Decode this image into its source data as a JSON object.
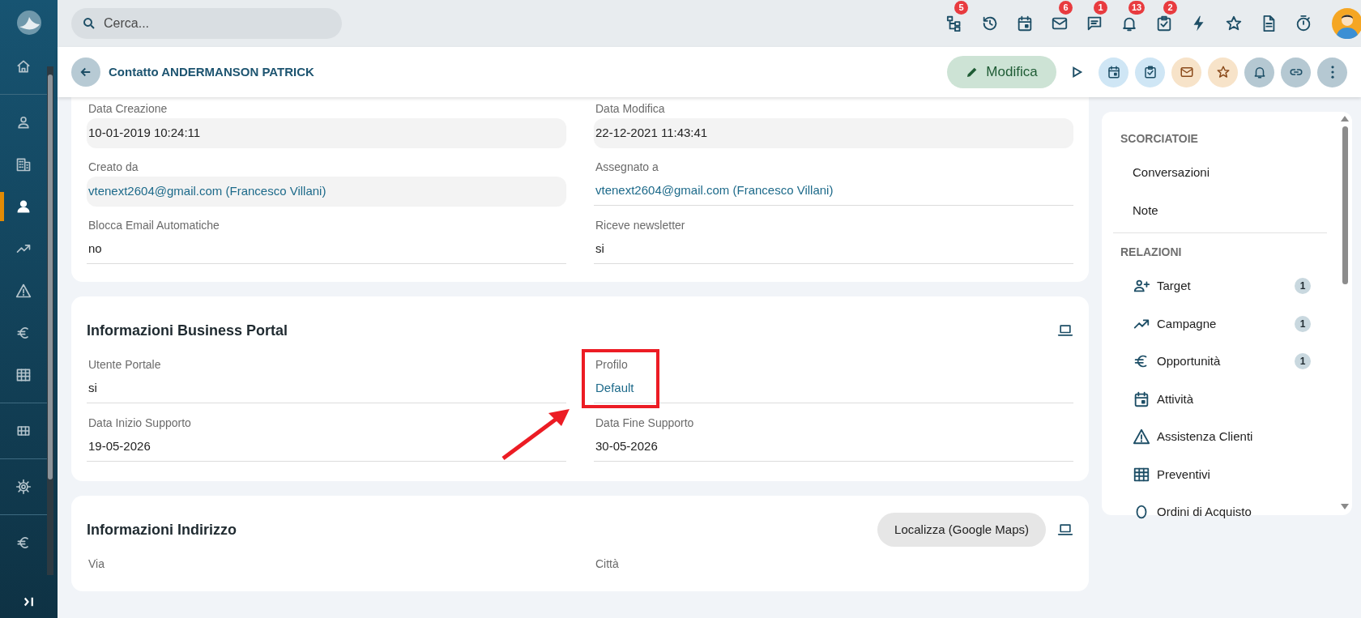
{
  "sidebar": {
    "items": [
      {
        "kind": "home",
        "selected": false
      },
      {
        "kind": "person-outline",
        "selected": false
      },
      {
        "kind": "building",
        "selected": false
      },
      {
        "kind": "person",
        "selected": true
      },
      {
        "kind": "trend",
        "selected": false
      },
      {
        "kind": "warning",
        "selected": false
      },
      {
        "kind": "euro",
        "selected": false
      },
      {
        "kind": "table",
        "selected": false
      },
      {
        "kind": "grid",
        "selected": false
      },
      {
        "kind": "gear",
        "selected": false
      },
      {
        "kind": "euro",
        "selected": false
      }
    ]
  },
  "search": {
    "placeholder": "Cerca..."
  },
  "toolbar_icons": [
    {
      "kind": "hierarchy",
      "badge": "5"
    },
    {
      "kind": "history"
    },
    {
      "kind": "calendar"
    },
    {
      "kind": "mail",
      "badge": "6"
    },
    {
      "kind": "chat",
      "badge": "1"
    },
    {
      "kind": "bell",
      "badge": "13"
    },
    {
      "kind": "task",
      "badge": "2"
    },
    {
      "kind": "bolt"
    },
    {
      "kind": "star"
    },
    {
      "kind": "document"
    },
    {
      "kind": "timer"
    }
  ],
  "header": {
    "title": "Contatto ANDERMANSON PATRICK",
    "edit_button": "Modifica",
    "actions": [
      {
        "kind": "calendar",
        "color": "#cfe6f5"
      },
      {
        "kind": "task",
        "color": "#cfe6f5"
      },
      {
        "kind": "mail",
        "color": "#f7e3c9"
      },
      {
        "kind": "star",
        "color": "#f7e3c9"
      },
      {
        "kind": "bell",
        "color": "#b5c8d2"
      },
      {
        "kind": "link",
        "color": "#b5c8d2"
      },
      {
        "kind": "more",
        "color": "#b5c8d2"
      }
    ]
  },
  "sections": [
    {
      "fields": [
        {
          "label": "Data Creazione",
          "value": "10-01-2019 10:24:11",
          "kind": "readonly",
          "link": false,
          "highlighted": false
        },
        {
          "label": "Data Modifica",
          "value": "22-12-2021 11:43:41",
          "kind": "readonly",
          "link": false,
          "highlighted": false
        },
        {
          "label": "Creato da",
          "value": "vtenext2604@gmail.com (Francesco Villani)",
          "kind": "readonly",
          "link": true,
          "highlighted": false
        },
        {
          "label": "Assegnato a",
          "value": "vtenext2604@gmail.com (Francesco Villani)",
          "kind": "editable",
          "link": true,
          "highlighted": false
        },
        {
          "label": "Blocca Email Automatiche",
          "value": "no",
          "kind": "editable",
          "link": false,
          "highlighted": false
        },
        {
          "label": "Riceve newsletter",
          "value": "si",
          "kind": "editable",
          "link": false,
          "highlighted": false
        }
      ]
    },
    {
      "title": "Informazioni Business Portal",
      "fields": [
        {
          "label": "Utente Portale",
          "value": "si",
          "kind": "editable",
          "link": false,
          "highlighted": false
        },
        {
          "label": "Profilo",
          "value": "Default",
          "kind": "editable",
          "link": true,
          "highlighted": true
        },
        {
          "label": "Data Inizio Supporto",
          "value": "19-05-2026",
          "kind": "editable",
          "link": false,
          "highlighted": false
        },
        {
          "label": "Data Fine Supporto",
          "value": "30-05-2026",
          "kind": "editable",
          "link": false,
          "highlighted": false
        }
      ]
    },
    {
      "title": "Informazioni Indirizzo",
      "button": "Localizza (Google Maps)",
      "fields": [
        {
          "label": "Via"
        },
        {
          "label": "Città"
        }
      ]
    }
  ],
  "side_panel": {
    "groups": [
      {
        "title": "SCORCIATOIE",
        "items": [
          {
            "label": "Conversazioni",
            "kind": "plain"
          },
          {
            "label": "Note",
            "kind": "plain"
          }
        ]
      },
      {
        "title": "RELAZIONI",
        "items": [
          {
            "label": "Target",
            "kind": "people-add",
            "count": "1"
          },
          {
            "label": "Campagne",
            "kind": "trend",
            "count": "1"
          },
          {
            "label": "Opportunità",
            "kind": "euro",
            "count": "1"
          },
          {
            "label": "Attività",
            "kind": "calendar"
          },
          {
            "label": "Assistenza Clienti",
            "kind": "warning"
          },
          {
            "label": "Preventivi",
            "kind": "table"
          },
          {
            "label": "Ordini di Acquisto",
            "kind": "circle"
          }
        ]
      }
    ]
  }
}
